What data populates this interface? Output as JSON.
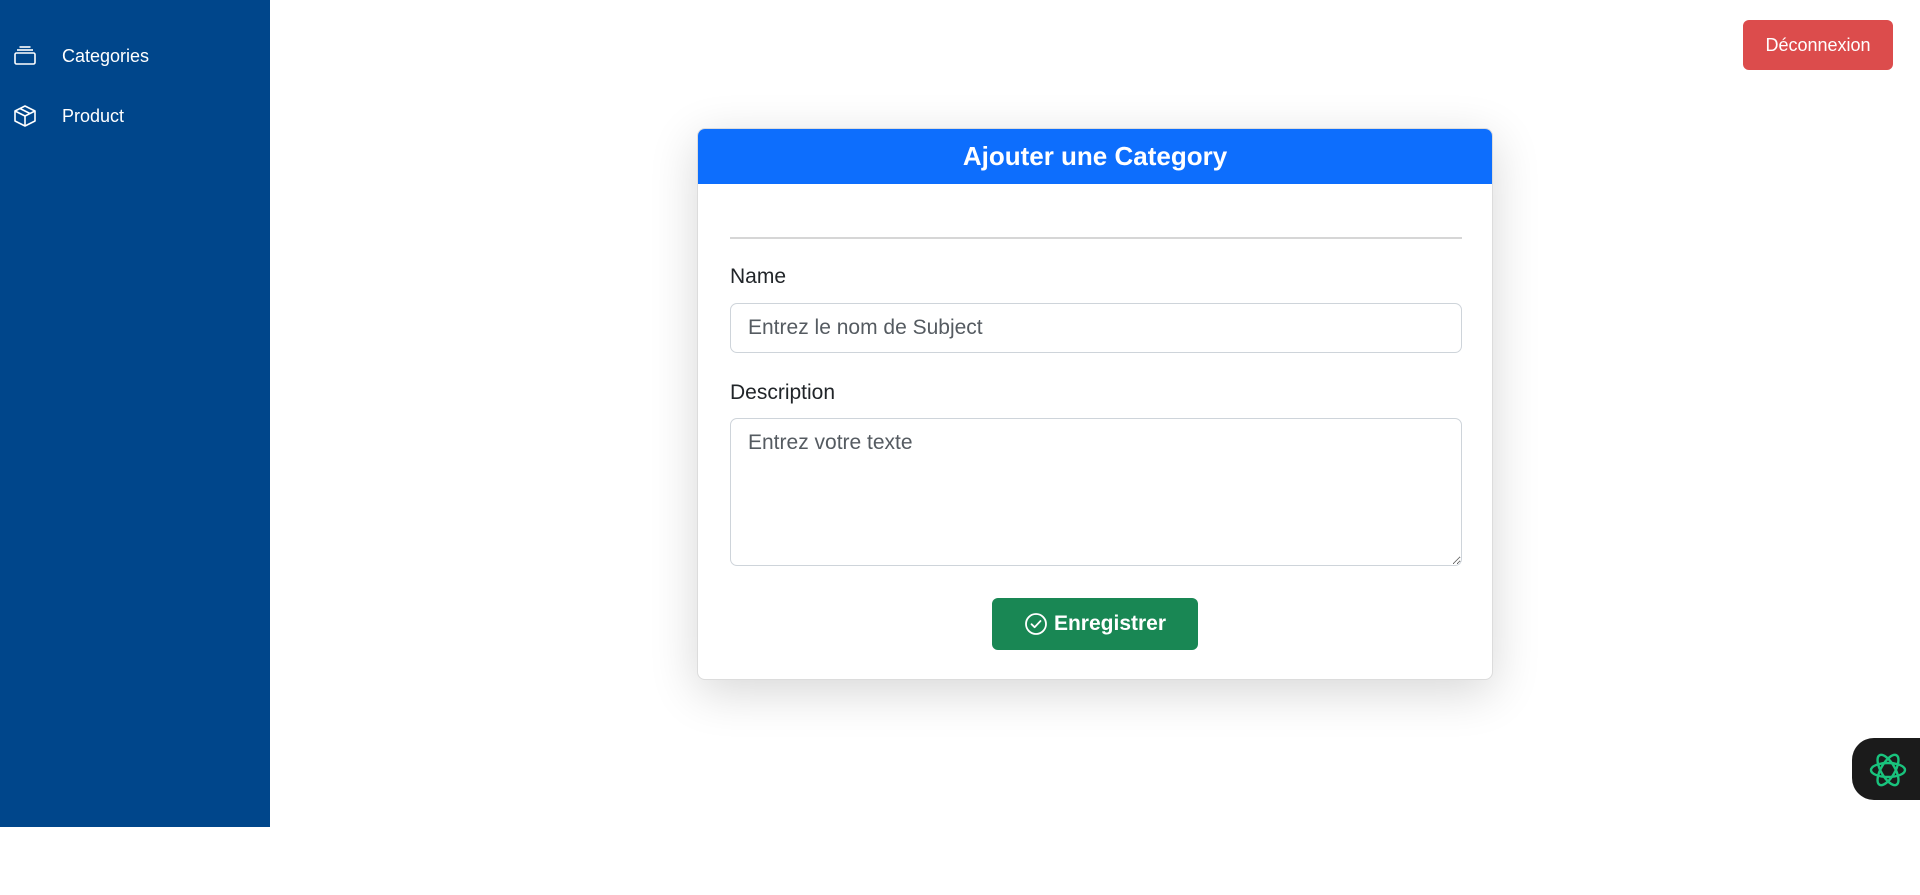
{
  "sidebar": {
    "items": [
      {
        "label": "Categories",
        "icon": "collection-icon"
      },
      {
        "label": "Product",
        "icon": "box-icon"
      }
    ]
  },
  "header": {
    "logout_label": "Déconnexion"
  },
  "form": {
    "title": "Ajouter une Category",
    "name_label": "Name",
    "name_placeholder": "Entrez le nom de Subject",
    "name_value": "",
    "description_label": "Description",
    "description_placeholder": "Entrez votre texte",
    "description_value": "",
    "submit_label": "Enregistrer"
  },
  "colors": {
    "sidebar": "#00468b",
    "card_header": "#0d6efd",
    "logout": "#dc4c4c",
    "submit": "#198754",
    "assistant_icon": "#19c37d"
  }
}
